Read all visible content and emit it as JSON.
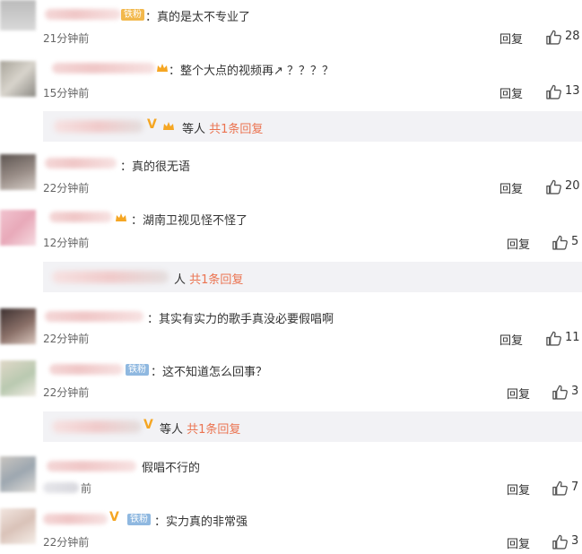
{
  "reply_label": "回复",
  "comments": [
    {
      "text": "：真的是太不专业了",
      "time": "21分钟前",
      "likes": "28",
      "badge": "铁粉"
    },
    {
      "text": "：整个大点的视频再↗ ？？？？",
      "time": "15分钟前",
      "likes": "13"
    },
    {
      "text": "：真的很无语",
      "time": "22分钟前",
      "likes": "20"
    },
    {
      "text": "：湖南卫视见怪不怪了",
      "time": "12分钟前",
      "likes": "5"
    },
    {
      "text": "：其实有实力的歌手真没必要假唱啊",
      "time": "22分钟前",
      "likes": "11"
    },
    {
      "text": "：这不知道怎么回事？",
      "time": "22分钟前",
      "likes": "3",
      "badge": "铁粉"
    },
    {
      "text": "假唱不行的",
      "time": "前",
      "likes": "7"
    },
    {
      "text": "：实力真的非常强",
      "time": "22分钟前",
      "likes": "3",
      "badge": "铁粉"
    }
  ],
  "subthreads": [
    {
      "prefix": "等人",
      "link": "共1条回复"
    },
    {
      "prefix": "人",
      "link": "共1条回复"
    },
    {
      "prefix": "等人",
      "link": "共1条回复"
    }
  ],
  "icons": [
    "thumbs-up-icon",
    "crown-icon",
    "verified-v-icon"
  ],
  "colors": {
    "link": "#eb7350",
    "gold_badge": "#f2b84c",
    "blue_badge": "#8fb8e0",
    "thread_bg": "#f2f2f5"
  }
}
